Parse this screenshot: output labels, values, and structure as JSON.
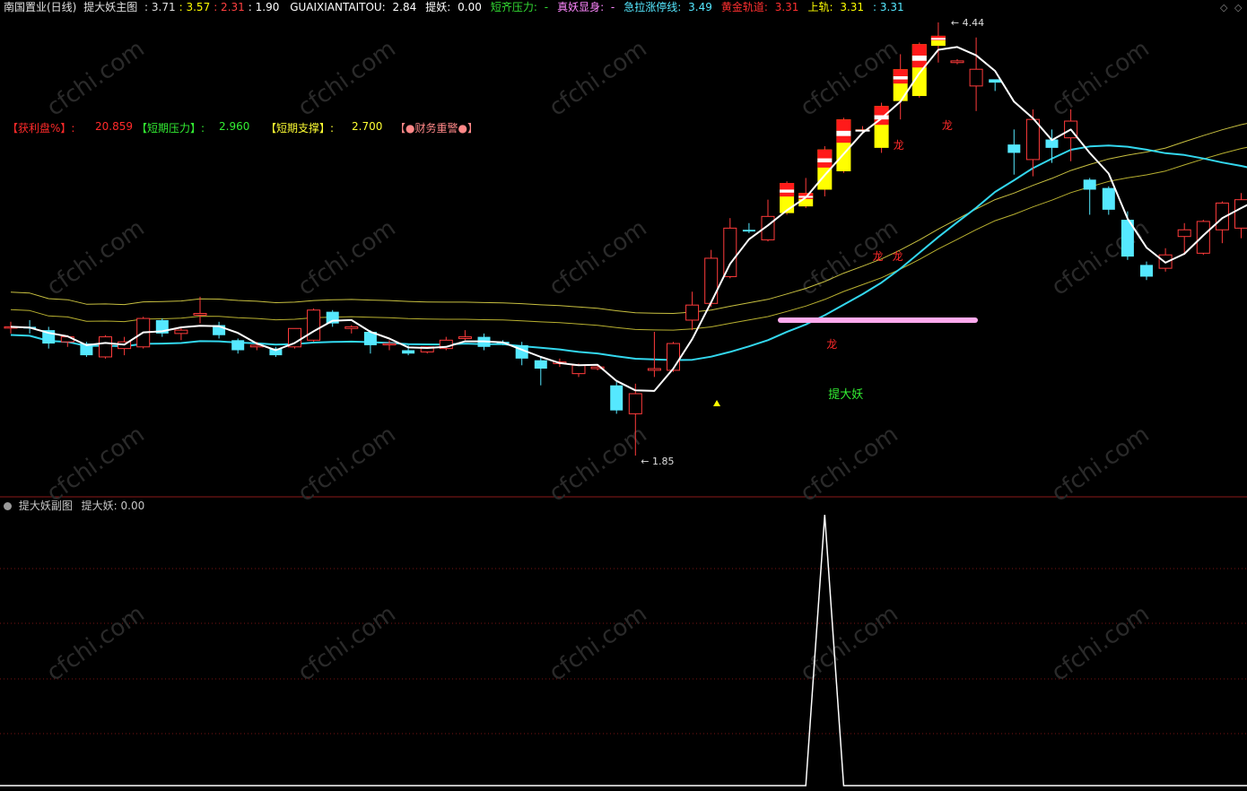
{
  "header": {
    "stock": "南国置业(日线)",
    "study": "提大妖主图",
    "values": [
      {
        "label": "",
        "value": "3.71",
        "color": "#e0e0e0"
      },
      {
        "label": "",
        "value": "3.57",
        "color": "#ffff00"
      },
      {
        "label": "",
        "value": "2.31",
        "color": "#ff4040"
      },
      {
        "label": "",
        "value": "1.90",
        "color": "#ffffff"
      }
    ],
    "indicators": [
      {
        "label": "GUAIXIANTAITOU:",
        "value": "2.84",
        "color": "#ffffff"
      },
      {
        "label": "提妖:",
        "value": "0.00",
        "color": "#ffffff"
      },
      {
        "label": "短齐压力:",
        "value": "-",
        "color": "#33dd33"
      },
      {
        "label": "真妖显身:",
        "value": "-",
        "color": "#ff88ff"
      },
      {
        "label": "急拉涨停线:",
        "value": "3.49",
        "color": "#55e8ff"
      },
      {
        "label": "黄金轨道:",
        "value": "3.31",
        "color": "#ff3030"
      },
      {
        "label": "上轨:",
        "value": "3.31",
        "color": "#ffff00"
      },
      {
        "label": "",
        "value": "3.31",
        "color": "#55e8ff"
      }
    ]
  },
  "stats": [
    {
      "label": "【获利盘%】:",
      "value": "20.859",
      "color": "#ff2a2a"
    },
    {
      "label": "【短期压力】:",
      "value": "2.960",
      "color": "#33ee33"
    },
    {
      "label": "【短期支撑】:",
      "value": "2.700",
      "color": "#ffff33"
    },
    {
      "label": "【●财务重警●】",
      "value": "",
      "color": "#ff8888"
    }
  ],
  "sub_header": {
    "title": "提大妖副图",
    "label": "提大妖:",
    "value": "0.00"
  },
  "annotations": {
    "high": "4.44",
    "low": "1.85",
    "signal": "提大妖",
    "dragon": "龙"
  },
  "watermark": "cfchi.com",
  "chart_data": {
    "type": "candlestick",
    "candles": [
      {
        "o": 2.62,
        "h": 2.65,
        "l": 2.58,
        "c": 2.62
      },
      {
        "o": 2.62,
        "h": 2.66,
        "l": 2.58,
        "c": 2.61
      },
      {
        "o": 2.6,
        "h": 2.62,
        "l": 2.49,
        "c": 2.52
      },
      {
        "o": 2.53,
        "h": 2.57,
        "l": 2.5,
        "c": 2.56
      },
      {
        "o": 2.52,
        "h": 2.53,
        "l": 2.44,
        "c": 2.45
      },
      {
        "o": 2.44,
        "h": 2.57,
        "l": 2.43,
        "c": 2.56
      },
      {
        "o": 2.49,
        "h": 2.56,
        "l": 2.45,
        "c": 2.53
      },
      {
        "o": 2.5,
        "h": 2.68,
        "l": 2.49,
        "c": 2.67
      },
      {
        "o": 2.66,
        "h": 2.67,
        "l": 2.56,
        "c": 2.58
      },
      {
        "o": 2.58,
        "h": 2.62,
        "l": 2.54,
        "c": 2.6
      },
      {
        "o": 2.69,
        "h": 2.8,
        "l": 2.64,
        "c": 2.7
      },
      {
        "o": 2.63,
        "h": 2.65,
        "l": 2.55,
        "c": 2.57
      },
      {
        "o": 2.54,
        "h": 2.55,
        "l": 2.46,
        "c": 2.48
      },
      {
        "o": 2.5,
        "h": 2.53,
        "l": 2.48,
        "c": 2.51
      },
      {
        "o": 2.49,
        "h": 2.5,
        "l": 2.44,
        "c": 2.45
      },
      {
        "o": 2.5,
        "h": 2.61,
        "l": 2.49,
        "c": 2.61
      },
      {
        "o": 2.54,
        "h": 2.73,
        "l": 2.53,
        "c": 2.72
      },
      {
        "o": 2.71,
        "h": 2.72,
        "l": 2.62,
        "c": 2.64
      },
      {
        "o": 2.61,
        "h": 2.63,
        "l": 2.58,
        "c": 2.62
      },
      {
        "o": 2.59,
        "h": 2.6,
        "l": 2.46,
        "c": 2.51
      },
      {
        "o": 2.52,
        "h": 2.54,
        "l": 2.48,
        "c": 2.52
      },
      {
        "o": 2.48,
        "h": 2.51,
        "l": 2.45,
        "c": 2.46
      },
      {
        "o": 2.47,
        "h": 2.5,
        "l": 2.46,
        "c": 2.5
      },
      {
        "o": 2.49,
        "h": 2.56,
        "l": 2.48,
        "c": 2.54
      },
      {
        "o": 2.55,
        "h": 2.6,
        "l": 2.54,
        "c": 2.56
      },
      {
        "o": 2.56,
        "h": 2.58,
        "l": 2.48,
        "c": 2.5
      },
      {
        "o": 2.53,
        "h": 2.54,
        "l": 2.51,
        "c": 2.52
      },
      {
        "o": 2.51,
        "h": 2.53,
        "l": 2.39,
        "c": 2.43
      },
      {
        "o": 2.42,
        "h": 2.44,
        "l": 2.27,
        "c": 2.37
      },
      {
        "o": 2.4,
        "h": 2.43,
        "l": 2.38,
        "c": 2.41
      },
      {
        "o": 2.34,
        "h": 2.4,
        "l": 2.32,
        "c": 2.39
      },
      {
        "o": 2.37,
        "h": 2.39,
        "l": 2.36,
        "c": 2.38
      },
      {
        "o": 2.27,
        "h": 2.29,
        "l": 2.1,
        "c": 2.12
      },
      {
        "o": 2.1,
        "h": 2.28,
        "l": 1.85,
        "c": 2.22
      },
      {
        "o": 2.36,
        "h": 2.59,
        "l": 2.32,
        "c": 2.37
      },
      {
        "o": 2.36,
        "h": 2.53,
        "l": 2.35,
        "c": 2.52
      },
      {
        "o": 2.66,
        "h": 2.83,
        "l": 2.6,
        "c": 2.75
      },
      {
        "o": 2.76,
        "h": 3.08,
        "l": 2.74,
        "c": 3.03
      },
      {
        "o": 2.92,
        "h": 3.27,
        "l": 2.91,
        "c": 3.21
      },
      {
        "o": 3.2,
        "h": 3.24,
        "l": 3.18,
        "c": 3.19
      },
      {
        "o": 3.14,
        "h": 3.38,
        "l": 3.13,
        "c": 3.28
      },
      {
        "o": 3.3,
        "h": 3.49,
        "l": 3.29,
        "c": 3.48
      },
      {
        "o": 3.34,
        "h": 3.51,
        "l": 3.33,
        "c": 3.42
      },
      {
        "o": 3.44,
        "h": 3.7,
        "l": 3.4,
        "c": 3.68
      },
      {
        "o": 3.55,
        "h": 3.87,
        "l": 3.54,
        "c": 3.86
      },
      {
        "o": 3.8,
        "h": 3.82,
        "l": 3.78,
        "c": 3.8
      },
      {
        "o": 3.69,
        "h": 3.96,
        "l": 3.66,
        "c": 3.94
      },
      {
        "o": 3.97,
        "h": 4.25,
        "l": 3.86,
        "c": 4.16
      },
      {
        "o": 4.0,
        "h": 4.32,
        "l": 3.99,
        "c": 4.31
      },
      {
        "o": 4.3,
        "h": 4.44,
        "l": 4.2,
        "c": 4.36
      },
      {
        "o": 4.2,
        "h": 4.22,
        "l": 4.19,
        "c": 4.21
      },
      {
        "o": 4.06,
        "h": 4.35,
        "l": 3.91,
        "c": 4.16
      },
      {
        "o": 4.1,
        "h": 4.08,
        "l": 4.03,
        "c": 4.08
      },
      {
        "o": 3.71,
        "h": 3.8,
        "l": 3.53,
        "c": 3.66
      },
      {
        "o": 3.62,
        "h": 3.92,
        "l": 3.52,
        "c": 3.86
      },
      {
        "o": 3.74,
        "h": 3.8,
        "l": 3.6,
        "c": 3.69
      },
      {
        "o": 3.75,
        "h": 3.92,
        "l": 3.61,
        "c": 3.85
      },
      {
        "o": 3.5,
        "h": 3.51,
        "l": 3.29,
        "c": 3.44
      },
      {
        "o": 3.45,
        "h": 3.46,
        "l": 3.29,
        "c": 3.32
      },
      {
        "o": 3.26,
        "h": 3.31,
        "l": 3.02,
        "c": 3.04
      },
      {
        "o": 2.99,
        "h": 3.01,
        "l": 2.9,
        "c": 2.92
      },
      {
        "o": 2.97,
        "h": 3.09,
        "l": 2.95,
        "c": 3.05
      },
      {
        "o": 3.16,
        "h": 3.24,
        "l": 3.05,
        "c": 3.2
      },
      {
        "o": 3.06,
        "h": 3.26,
        "l": 3.05,
        "c": 3.25
      },
      {
        "o": 3.2,
        "h": 3.37,
        "l": 3.12,
        "c": 3.36
      },
      {
        "o": 3.21,
        "h": 3.42,
        "l": 3.15,
        "c": 3.38
      },
      {
        "o": 3.38,
        "h": 3.44,
        "l": 3.35,
        "c": 3.42
      },
      {
        "o": 3.33,
        "h": 3.42,
        "l": 3.28,
        "c": 3.29
      },
      {
        "o": 3.22,
        "h": 3.24,
        "l": 3.14,
        "c": 3.17
      }
    ],
    "sub_series": {
      "name": "提大妖",
      "peak_index": 43,
      "peak_value": 1.0,
      "value": 0.0
    }
  }
}
